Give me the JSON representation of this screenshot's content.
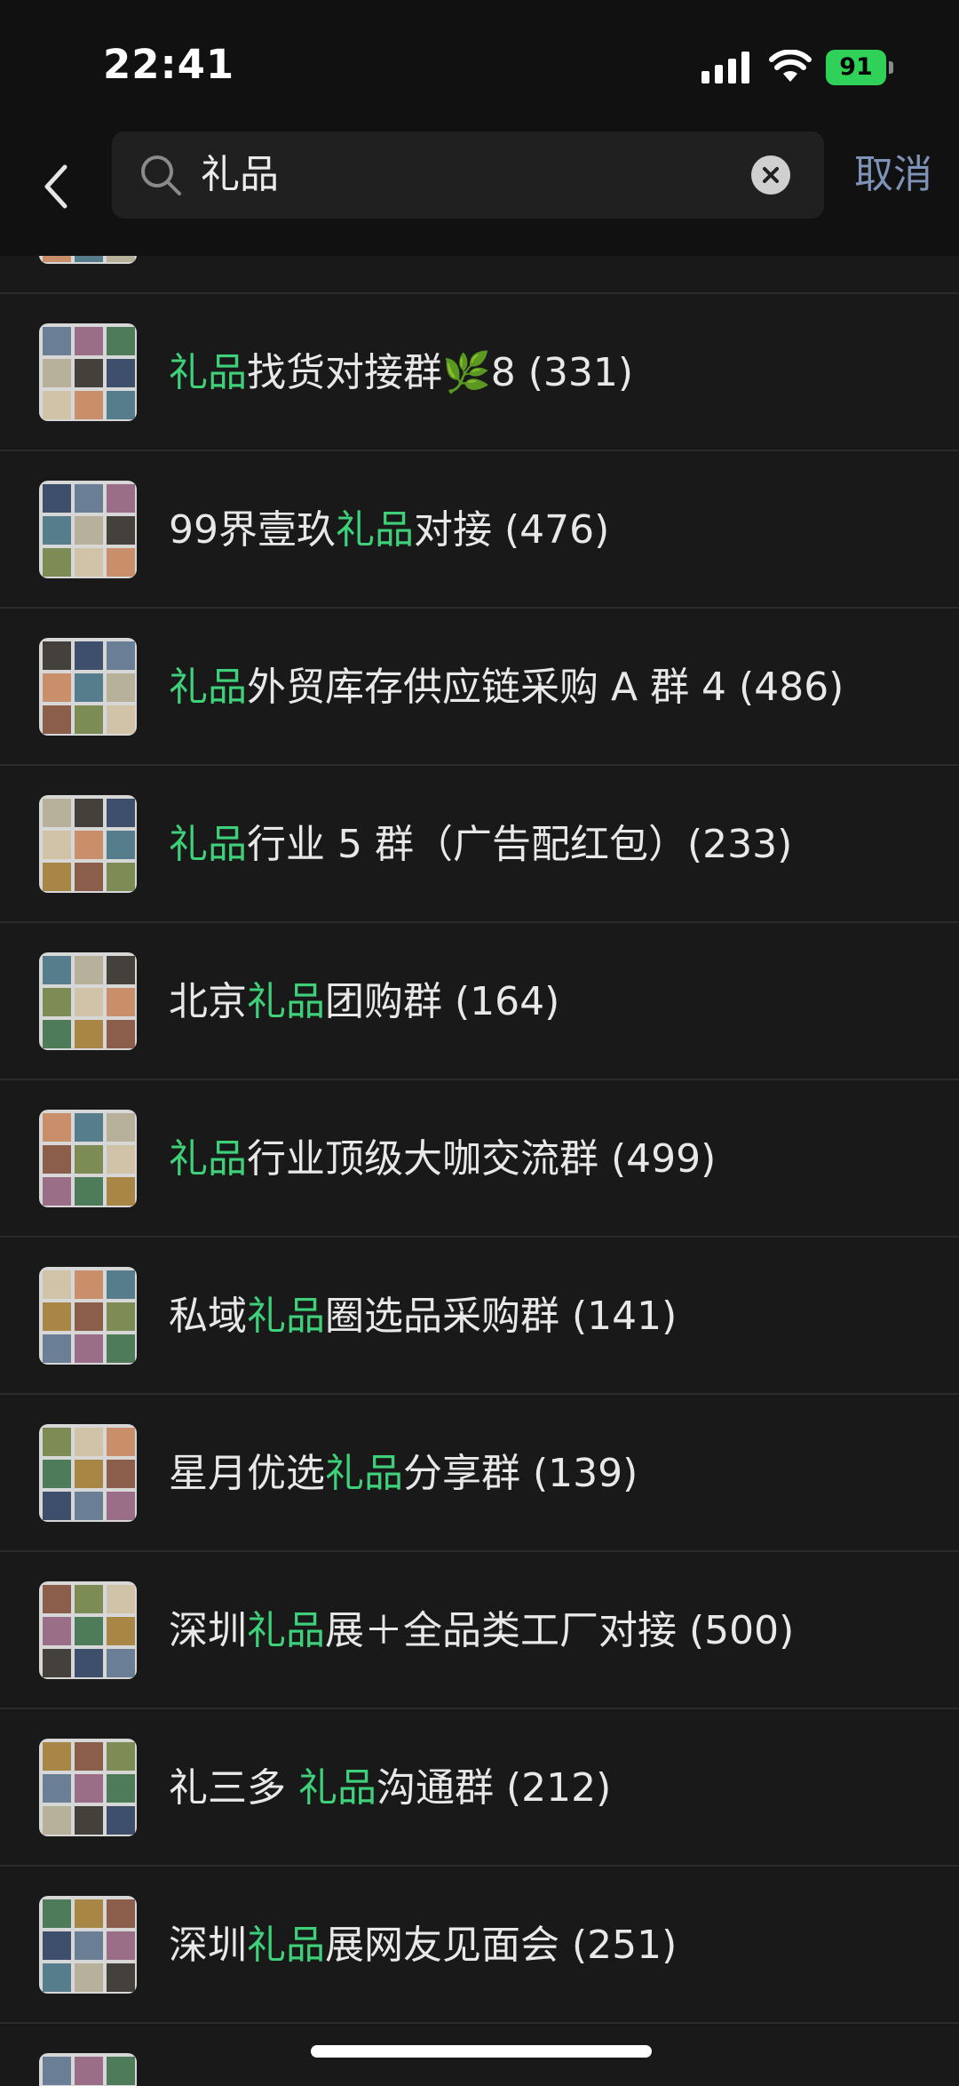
{
  "status_bar": {
    "time": "22:41",
    "battery_level": "91",
    "battery_color": "#30d158"
  },
  "search": {
    "query": "礼品",
    "cancel_label": "取消",
    "icons": [
      "chevron-left-icon",
      "search-icon",
      "clear-icon"
    ]
  },
  "theme": {
    "background": "#191919",
    "highlight": "#3fd17a",
    "text": "#e8e8e8",
    "cancel": "#7f93b8"
  },
  "results": [
    {
      "prefix": "",
      "match": "礼品",
      "suffix": "找货对接群🌿8 (331)"
    },
    {
      "prefix": "99界壹玖",
      "match": "礼品",
      "suffix": "对接 (476)"
    },
    {
      "prefix": "",
      "match": "礼品",
      "suffix": "外贸库存供应链采购 A 群 4 (486)"
    },
    {
      "prefix": "",
      "match": "礼品",
      "suffix": "行业 5 群（广告配红包）(233)"
    },
    {
      "prefix": "北京",
      "match": "礼品",
      "suffix": "团购群 (164)"
    },
    {
      "prefix": "",
      "match": "礼品",
      "suffix": "行业顶级大咖交流群 (499)"
    },
    {
      "prefix": "私域",
      "match": "礼品",
      "suffix": "圈选品采购群 (141)"
    },
    {
      "prefix": "星月优选",
      "match": "礼品",
      "suffix": "分享群 (139)"
    },
    {
      "prefix": "深圳",
      "match": "礼品",
      "suffix": "展＋全品类工厂对接 (500)"
    },
    {
      "prefix": "礼三多 ",
      "match": "礼品",
      "suffix": "沟通群 (212)"
    },
    {
      "prefix": "深圳",
      "match": "礼品",
      "suffix": "展网友见面会 (251)"
    }
  ]
}
